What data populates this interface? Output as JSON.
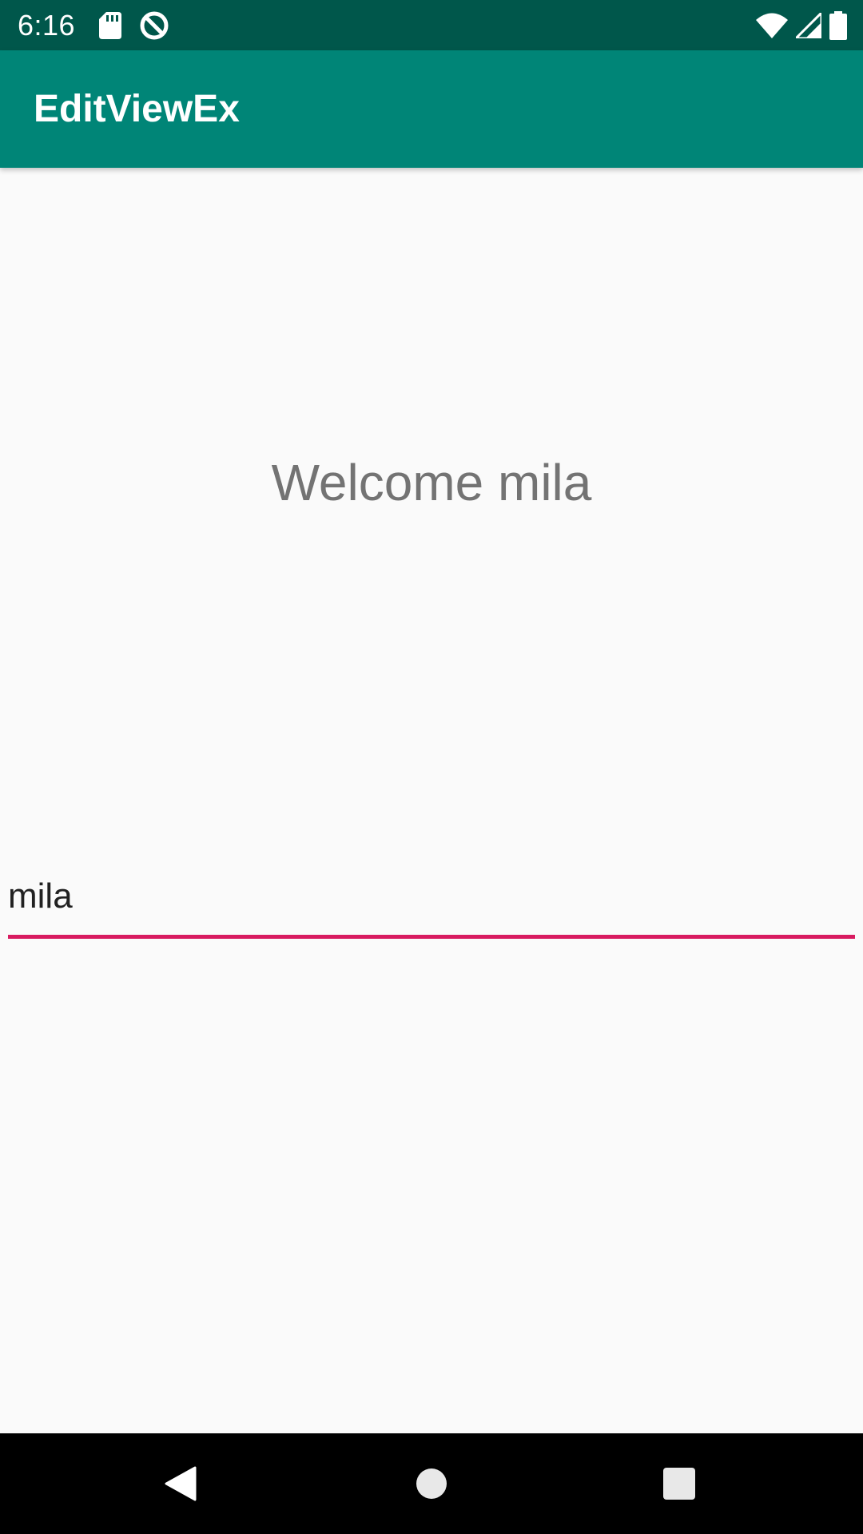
{
  "status_bar": {
    "time": "6:16",
    "background": "#00574b",
    "left_icons": [
      "sd-card-icon",
      "data-saver-icon"
    ],
    "right_icons": [
      "wifi-icon",
      "cell-signal-icon",
      "battery-icon"
    ]
  },
  "app_bar": {
    "title": "EditViewEx",
    "background": "#008577"
  },
  "content": {
    "welcome_text": "Welcome mila",
    "name_input_value": "mila",
    "accent_color": "#d81b60",
    "background": "#fafafa"
  },
  "nav_bar": {
    "buttons": [
      "back-icon",
      "home-icon",
      "recents-icon"
    ]
  }
}
